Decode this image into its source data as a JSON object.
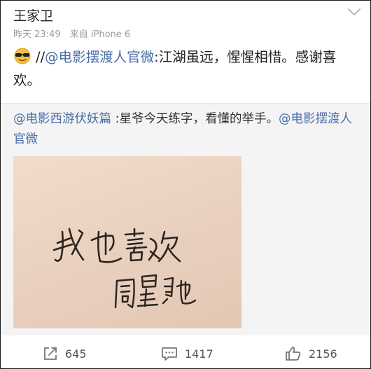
{
  "post": {
    "author": "王家卫",
    "time": "昨天 23:49",
    "source": "来自 iPhone 6",
    "slashes": "//",
    "mention": "@电影摆渡人官微",
    "text": ":江湖虽远，惺惺相惜。感谢喜欢。"
  },
  "repost": {
    "mention_prefix": "@电影西游伏妖篇",
    "text": " :星爷今天练字，看懂的举手。",
    "mention_suffix": "@电影摆渡人官微"
  },
  "image": {
    "handwriting_line1": "我也喜欢",
    "signature": "周星驰"
  },
  "actions": {
    "reposts": "645",
    "comments": "1417",
    "likes": "2156"
  },
  "colors": {
    "link": "#4a6ea9",
    "meta": "#9a9a9a",
    "quote_bg": "#f4f4f4"
  }
}
